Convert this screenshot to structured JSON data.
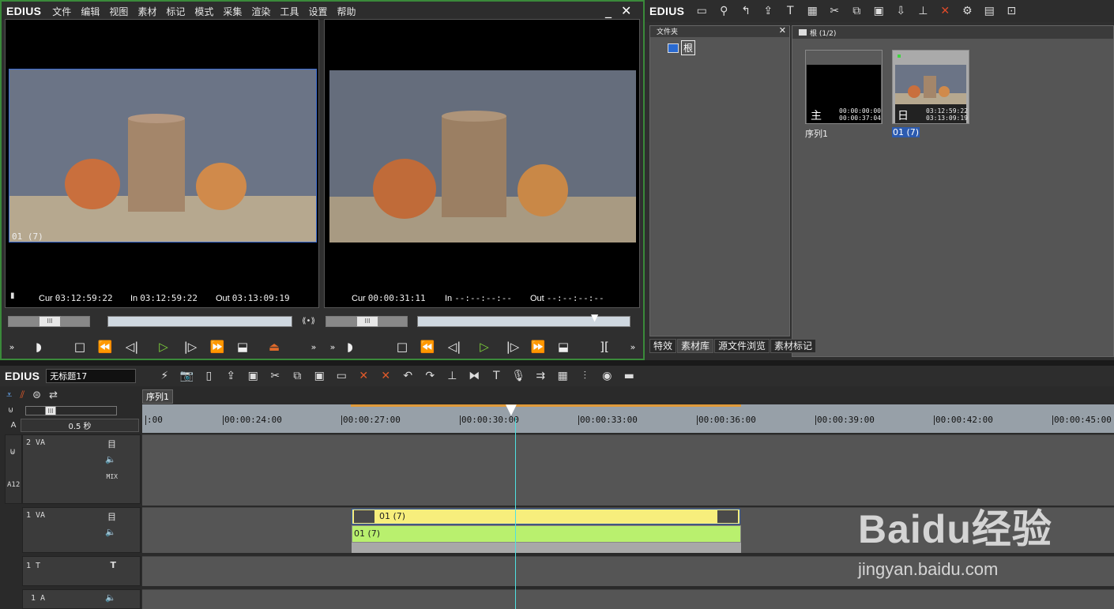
{
  "app": {
    "logo": "EDIUS"
  },
  "player_window": {
    "menu": [
      "文件",
      "编辑",
      "视图",
      "素材",
      "标记",
      "模式",
      "采集",
      "渲染",
      "工具",
      "设置",
      "帮助"
    ],
    "minimize": "_",
    "close": "✕",
    "source": {
      "clip_label": "01 (7)",
      "cur_label": "Cur",
      "cur": "03:12:59:22",
      "in_label": "In",
      "in": "03:12:59:22",
      "out_label": "Out",
      "out": "03:13:09:19"
    },
    "record": {
      "cur_label": "Cur",
      "cur": "00:00:31:11",
      "in_label": "In",
      "in": "--:--:--:--",
      "out_label": "Out",
      "out": "--:--:--:--"
    }
  },
  "bin_window": {
    "logo": "EDIUS",
    "folder_panel_title": "文件夹",
    "root_label": "根",
    "bin_header": "根 (1/2)",
    "items": [
      {
        "name": "序列1",
        "tc1": "00:00:00:00",
        "tc2": "00:00:37:04",
        "badge": "主",
        "selected": false
      },
      {
        "name": "01 (7)",
        "tc1": "03:12:59:22",
        "tc2": "03:13:09:19",
        "badge": "日",
        "selected": true
      }
    ],
    "tabs": [
      "特效",
      "素材库",
      "源文件浏览",
      "素材标记"
    ],
    "active_tab": "素材库"
  },
  "timeline": {
    "logo": "EDIUS",
    "project_name": "无标题17",
    "sequence_tab": "序列1",
    "zoom_label": "0.5 秒",
    "ruler_ticks": [
      ":00",
      "00:00:24:00",
      "00:00:27:00",
      "00:00:30:00",
      "00:00:33:00",
      "00:00:36:00",
      "00:00:39:00",
      "00:00:42:00",
      "00:00:45:00"
    ],
    "tracks": [
      {
        "name": "2 VA",
        "mix": "MIX"
      },
      {
        "name": "1 VA"
      },
      {
        "name": "1 T"
      },
      {
        "name": "1 A"
      }
    ],
    "ab_label": "A12",
    "clip_video_label": "01 (7)",
    "clip_audio_label": "01 (7)"
  },
  "watermark": {
    "brand": "Baidu经验",
    "url": "jingyan.baidu.com"
  },
  "colors": {
    "accent_green": "#7fd43b",
    "clip_yellow": "#f7ee7c",
    "clip_green": "#b9f06e",
    "playhead": "#4fe0e0",
    "selection_blue": "#2c5bb0"
  }
}
